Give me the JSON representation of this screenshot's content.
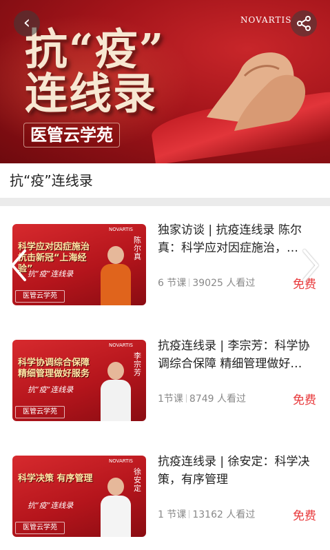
{
  "header": {
    "banner_title_line1": "抗“疫”",
    "banner_title_line2": "连线录",
    "banner_brand": "医管云学苑",
    "sponsor_logo": "NOVARTIS",
    "back_icon": "chevron-left-icon",
    "share_icon": "share-icon"
  },
  "section": {
    "title": "抗“疫”连线录"
  },
  "courses": [
    {
      "thumb_headline": "科学应对因症施治 抗击新冠“上海经验”",
      "thumb_series": "抗“疫”连线录",
      "thumb_brand": "医管云学苑",
      "thumb_name": "陈尔真",
      "title": "独家访谈 | 抗疫连线录 陈尔真：科学应对因症施治，…",
      "lessons": "6 节课",
      "views": "39025 人看过",
      "price": "免费",
      "accent": "#e8383a"
    },
    {
      "thumb_headline": "科学协调综合保障 精细管理做好服务",
      "thumb_series": "抗“疫”连线录",
      "thumb_brand": "医管云学苑",
      "thumb_name": "李宗芳",
      "title": "抗疫连线录 | 李宗芳：科学协调综合保障 精细管理做好…",
      "lessons": "1节课",
      "views": "8749 人看过",
      "price": "免费",
      "accent": "#e8383a"
    },
    {
      "thumb_headline": "科学决策 有序管理",
      "thumb_series": "抗“疫”连线录",
      "thumb_brand": "医管云学苑",
      "thumb_name": "徐安定",
      "title": "抗疫连线录 | 徐安定：科学决策，有序管理",
      "lessons": "1 节课",
      "views": "13162 人看过",
      "price": "免费",
      "accent": "#e8383a"
    }
  ],
  "carousel": {
    "prev_icon": "chevron-left-icon",
    "next_icon": "chevron-right-icon"
  }
}
